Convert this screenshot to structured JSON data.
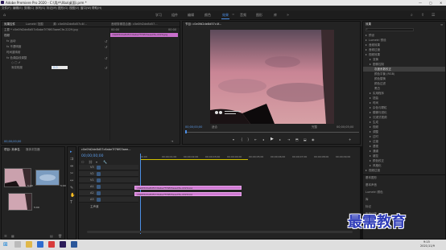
{
  "window": {
    "title": "Adobe Premiere Pro 2020 - C:\\用户\\Xba\\桌面\\.prm *",
    "min": "—",
    "max": "▢",
    "close": "✕"
  },
  "menu": [
    "文件(F)",
    "编辑(E)",
    "剪辑(C)",
    "序列(S)",
    "标记(M)",
    "图形(G)",
    "视图(V)",
    "窗口(W)",
    "帮助(H)"
  ],
  "workspaces": [
    {
      "label": "学习",
      "active": false
    },
    {
      "label": "组件",
      "active": false
    },
    {
      "label": "编辑",
      "active": false
    },
    {
      "label": "颜色",
      "active": false
    },
    {
      "label": "效果",
      "active": true
    },
    {
      "label": "音频",
      "active": false
    },
    {
      "label": "图形",
      "active": false
    },
    {
      "label": "库",
      "active": false
    }
  ],
  "source_panel": {
    "tabs": [
      "效果控件",
      "Lumetri 范围",
      "源: c0e0fd2de8d57c4f...",
      "音频剪辑混合器: c0e0fd2de8d57..."
    ],
    "master": "主要 * c0e0fd2de8d57c6abe7f76f03aeeCfe-2229.jpg",
    "clip_label": "c0e0fd2de8d57c6abe7f76f03aeeCfe-2229.jpg",
    "time_start": "00:00",
    "time_end": "00:00",
    "section": "视频",
    "rows": [
      {
        "label": "fx 运动",
        "indent": 0
      },
      {
        "label": "fx 不透明度",
        "indent": 0
      },
      {
        "label": "时间重映射",
        "indent": 0
      },
      {
        "label": "fx 色调曲线调整",
        "indent": 0
      },
      {
        "label": "○ □ ✐",
        "indent": 1
      },
      {
        "label": "渐变程度",
        "indent": 1
      }
    ],
    "gradient_value": "0.0",
    "timecode": "00;00;00;00"
  },
  "program_panel": {
    "title": "节目: c0e0fd2de8d57c4f...",
    "timecode_left": "00;00;00;00",
    "fit_label": "适合",
    "quality_label": "完整",
    "timecode_right": "00;00;05;00"
  },
  "project_panel": {
    "tabs": [
      "项目: 未命名",
      "媒体浏览器"
    ],
    "items": [
      {
        "duration": "5:00"
      },
      {
        "duration": "5:00"
      },
      {
        "duration": "5:00"
      }
    ]
  },
  "timeline": {
    "tab": "c0e0fd2de8d57c6abe7f76f03aee...",
    "timecode": "00;00;00;00",
    "ruler": [
      "00;00",
      "00;00;01;00",
      "00;00;02;00",
      "00;00;03;00",
      "00;00;04;00",
      "00;00;05;00",
      "00;00;06;00",
      "00;00;07;00",
      "00;00;08;00",
      "00;00;09;00"
    ],
    "tracks": [
      "V3",
      "V2",
      "V1",
      "A1",
      "A2",
      "A3"
    ],
    "master": "主声道",
    "clips": [
      {
        "label": "c0e0fd2de8d57c6abe7f76f03aeeCfe-2229.jpg"
      },
      {
        "label": "c0e0fd2de8d57c6abe7f76f03aeeCfe-2229.jpg"
      }
    ]
  },
  "effects_panel": {
    "title": "效果",
    "items": [
      {
        "label": "预设",
        "level": 0,
        "selected": false
      },
      {
        "label": "Lumetri 预设",
        "level": 0,
        "selected": false
      },
      {
        "label": "音频效果",
        "level": 0,
        "selected": false
      },
      {
        "label": "音频过渡",
        "level": 0,
        "selected": false
      },
      {
        "label": "视频效果",
        "level": 0,
        "selected": false
      },
      {
        "label": "变换",
        "level": 1,
        "selected": false
      },
      {
        "label": "图像控制",
        "level": 1,
        "selected": false
      },
      {
        "label": "灰度系数校正",
        "level": 2,
        "selected": true
      },
      {
        "label": "颜色平衡 (RGB)",
        "level": 2,
        "selected": false
      },
      {
        "label": "颜色替换",
        "level": 2,
        "selected": false
      },
      {
        "label": "颜色过滤",
        "level": 2,
        "selected": false
      },
      {
        "label": "黑白",
        "level": 2,
        "selected": false
      },
      {
        "label": "实用程序",
        "level": 1,
        "selected": false
      },
      {
        "label": "扭曲",
        "level": 1,
        "selected": false
      },
      {
        "label": "时间",
        "level": 1,
        "selected": false
      },
      {
        "label": "杂色与颗粒",
        "level": 1,
        "selected": false
      },
      {
        "label": "模糊与锐化",
        "level": 1,
        "selected": false
      },
      {
        "label": "沉浸式视频",
        "level": 1,
        "selected": false
      },
      {
        "label": "生成",
        "level": 1,
        "selected": false
      },
      {
        "label": "视频",
        "level": 1,
        "selected": false
      },
      {
        "label": "调整",
        "level": 1,
        "selected": false
      },
      {
        "label": "过时",
        "level": 1,
        "selected": false
      },
      {
        "label": "过渡",
        "level": 1,
        "selected": false
      },
      {
        "label": "透视",
        "level": 1,
        "selected": false
      },
      {
        "label": "通道",
        "level": 1,
        "selected": false
      },
      {
        "label": "键控",
        "level": 1,
        "selected": false
      },
      {
        "label": "颜色校正",
        "level": 1,
        "selected": false
      },
      {
        "label": "风格化",
        "level": 1,
        "selected": false
      },
      {
        "label": "视频过渡",
        "level": 0,
        "selected": false
      }
    ],
    "bottom": [
      "基本图形",
      "基本声音",
      "Lumetri 颜色",
      "库",
      "标记",
      "历史记录",
      "信息"
    ]
  },
  "watermark": "最需教育",
  "taskbar": {
    "time": "9:15",
    "date": "2021/11/9"
  }
}
